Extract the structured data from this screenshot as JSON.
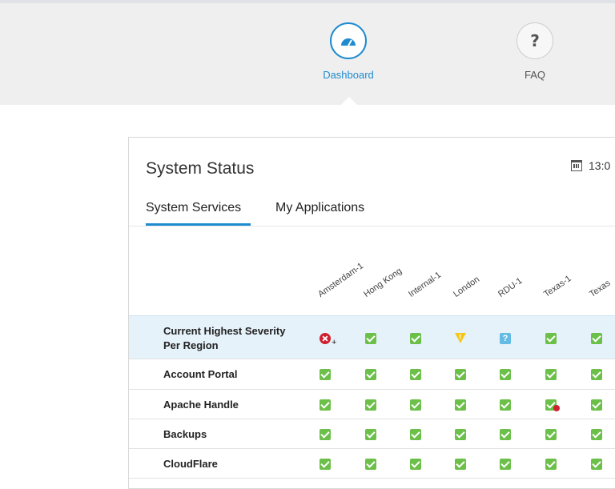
{
  "nav": {
    "items": [
      {
        "label": "Dashboard",
        "icon": "speedometer-icon",
        "active": true
      },
      {
        "label": "FAQ",
        "icon": "question-mark-icon",
        "active": false
      }
    ]
  },
  "card": {
    "title": "System Status",
    "timestamp": "13:0",
    "tabs": [
      {
        "label": "System Services",
        "active": true
      },
      {
        "label": "My Applications",
        "active": false
      }
    ]
  },
  "table": {
    "columns": [
      "Amsterdam-1",
      "Hong Kong",
      "Internal-1",
      "London",
      "RDU-1",
      "Texas-1",
      "Texas"
    ],
    "rows": [
      {
        "label": "Current Highest Severity\nPer Region",
        "statuses": [
          "critical",
          "ok",
          "ok",
          "warning",
          "unknown",
          "ok",
          "ok"
        ]
      },
      {
        "label": "Account Portal",
        "statuses": [
          "ok",
          "ok",
          "ok",
          "ok",
          "ok",
          "ok",
          "ok"
        ]
      },
      {
        "label": "Apache Handle",
        "statuses": [
          "ok",
          "ok",
          "ok",
          "ok",
          "ok",
          "ok-with-error",
          "ok"
        ]
      },
      {
        "label": "Backups",
        "statuses": [
          "ok",
          "ok",
          "ok",
          "ok",
          "ok",
          "ok",
          "ok"
        ]
      },
      {
        "label": "CloudFlare",
        "statuses": [
          "ok",
          "ok",
          "ok",
          "ok",
          "ok",
          "ok",
          "ok"
        ]
      }
    ]
  },
  "colors": {
    "accent": "#1e8bd0",
    "ok": "#6cc04a",
    "warning": "#f5c518",
    "critical": "#cf2030",
    "unknown": "#64bbe3",
    "highlight_row": "#e6f2fa"
  }
}
